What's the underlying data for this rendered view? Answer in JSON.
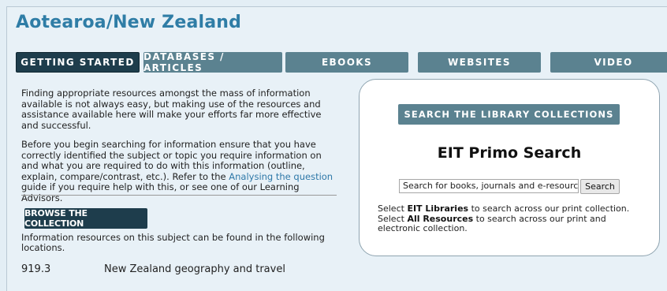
{
  "header": {
    "title": "Aotearoa/New Zealand"
  },
  "tabs": [
    {
      "label": "GETTING STARTED",
      "active": true
    },
    {
      "label": "DATABASES / ARTICLES",
      "active": false
    },
    {
      "label": "EBOOKS",
      "active": false
    },
    {
      "label": "WEBSITES",
      "active": false
    },
    {
      "label": "VIDEO",
      "active": false
    }
  ],
  "intro": {
    "para1": "Finding appropriate resources amongst the mass of information available is not always easy, but making use of the resources and assistance available here will make your efforts far more effective and successful.",
    "para2_before": "Before you begin searching for information ensure that you have correctly identified the subject or topic you require information on and what you are required to do with this information (outline, explain, compare/contrast, etc.). Refer to the ",
    "para2_link": "Analysing the question",
    "para2_after": " guide if you require help with this, or see one of our Learning Advisors."
  },
  "browse": {
    "button_label": "BROWSE THE COLLECTION",
    "locations_text": "Information resources on this subject can be found in the following locations."
  },
  "call_numbers": [
    {
      "number": "919.3",
      "subject": "New Zealand geography and travel"
    }
  ],
  "search_panel": {
    "button_label": "SEARCH THE LIBRARY COLLECTIONS",
    "title": "EIT Primo Search",
    "input_placeholder": "Search for books, journals and e-resources",
    "search_button": "Search",
    "line1_before": "Select ",
    "line1_bold": "EIT Libraries",
    "line1_after": " to search across our print collection.",
    "line2_before": "Select ",
    "line2_bold": "All Resources",
    "line2_after": " to search across our print and electronic collection."
  },
  "colors": {
    "title": "#2f7da6",
    "tab_active": "#1e3d4c",
    "tab_inactive": "#5b8290",
    "link": "#2e78a8"
  }
}
